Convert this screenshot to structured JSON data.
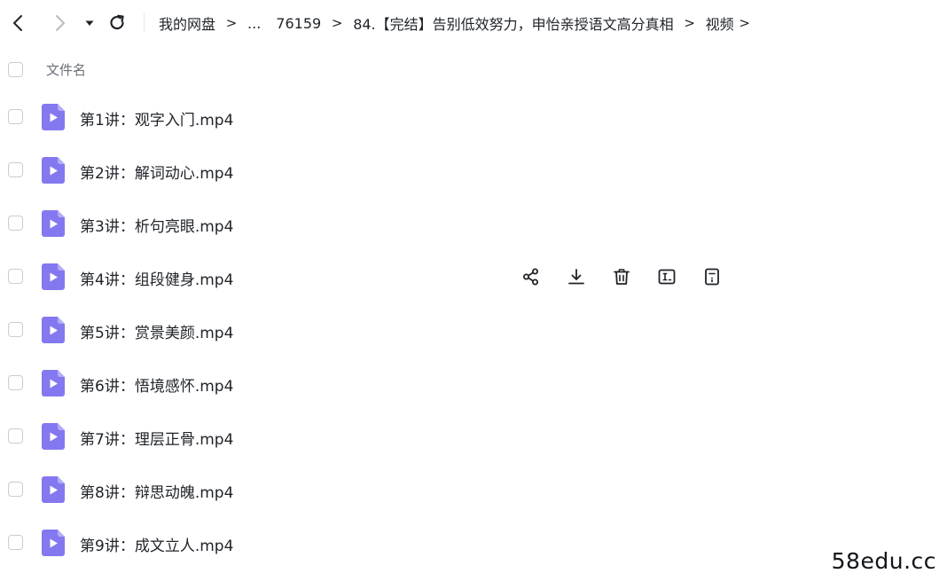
{
  "breadcrumb": {
    "root": "我的网盘",
    "ellipsis": "...",
    "level1": "76159",
    "level2": "84.【完结】告别低效努力，申怡亲授语文高分真相",
    "level3": "视频",
    "separator": ">"
  },
  "list": {
    "column_name": "文件名",
    "files": [
      {
        "name": "第1讲：观字入门.mp4"
      },
      {
        "name": "第2讲：解词动心.mp4"
      },
      {
        "name": "第3讲：析句亮眼.mp4"
      },
      {
        "name": "第4讲：组段健身.mp4"
      },
      {
        "name": "第5讲：赏景美颜.mp4"
      },
      {
        "name": "第6讲：悟境感怀.mp4"
      },
      {
        "name": "第7讲：理层正骨.mp4"
      },
      {
        "name": "第8讲：辩思动魄.mp4"
      },
      {
        "name": "第9讲：成文立人.mp4"
      }
    ],
    "hovered_row_index": 3
  },
  "icons": {
    "nav_back": "chevron-left-icon",
    "nav_forward": "chevron-right-icon",
    "nav_history": "caret-down-icon",
    "nav_refresh": "refresh-icon",
    "file_type": "video-file-icon",
    "row_actions": [
      "share-icon",
      "download-icon",
      "delete-icon",
      "rename-icon",
      "details-icon"
    ]
  },
  "colors": {
    "file_icon": "#8478f0",
    "file_icon_fold": "#b3abf7",
    "text_primary": "#1f2329",
    "text_secondary": "#6b7079",
    "checkbox_border": "#c9ccd2"
  },
  "watermark": "58edu.cc"
}
